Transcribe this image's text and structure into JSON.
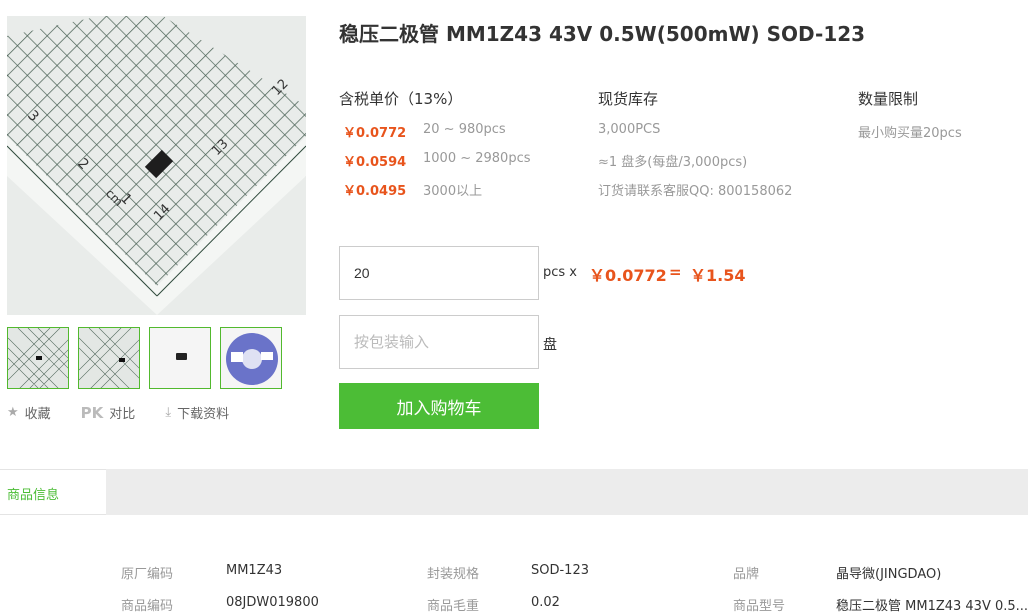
{
  "product": {
    "title": "稳压二极管 MM1Z43 43V 0.5W(500mW) SOD-123"
  },
  "pricing": {
    "header": "含税单价（13%）",
    "tiers": [
      {
        "price": "￥0.0772",
        "range": "20 ~ 980pcs"
      },
      {
        "price": "￥0.0594",
        "range": "1000 ~ 2980pcs"
      },
      {
        "price": "￥0.0495",
        "range": "3000以上"
      }
    ]
  },
  "stock": {
    "header": "现货库存",
    "lines": [
      "3,000PCS",
      "≈1 盘多(每盘/3,000pcs)",
      "订货请联系客服QQ: 800158062"
    ]
  },
  "limit": {
    "header": "数量限制",
    "text": "最小购买量20pcs"
  },
  "order": {
    "qty_value": "20",
    "unit_label": "pcs x",
    "unit_price": "￥0.0772",
    "equals": "=",
    "total": "￥1.54",
    "pack_placeholder": "按包装输入",
    "pack_unit": "盘",
    "cart_label": "加入购物车"
  },
  "actions": {
    "favorite": "收藏",
    "compare_pk": "PK",
    "compare": "对比",
    "download": "下载资料"
  },
  "tabs": {
    "active": "商品信息"
  },
  "specs": [
    {
      "key": "原厂编码",
      "value": "MM1Z43"
    },
    {
      "key": "封装规格",
      "value": "SOD-123"
    },
    {
      "key": "品牌",
      "value": "晶导微(JINGDAO)"
    },
    {
      "key": "商品编码",
      "value": "08JDW019800"
    },
    {
      "key": "商品毛重",
      "value": "0.02"
    },
    {
      "key": "商品型号",
      "value": "稳压二极管 MM1Z43 43V 0.5..."
    }
  ],
  "image": {
    "ruler_labels": [
      "3",
      "2",
      "1",
      "cm",
      "14",
      "13",
      "12"
    ]
  },
  "colors": {
    "accent_green": "#4cbd36",
    "price_orange": "#e8541c"
  }
}
